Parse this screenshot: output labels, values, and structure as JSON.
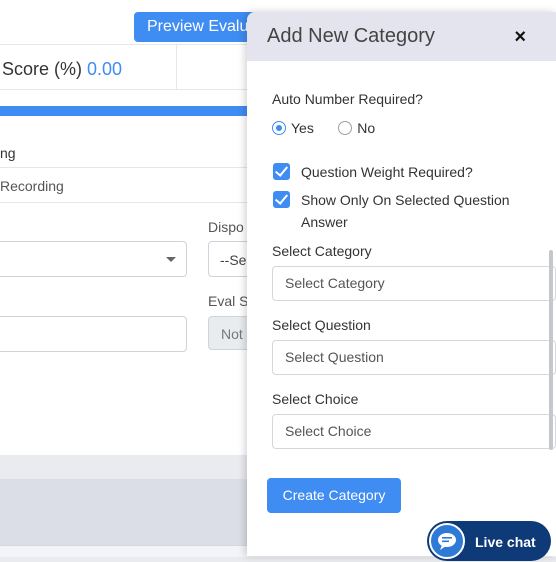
{
  "background": {
    "preview_button_label": "Preview Evaluation",
    "score_label": "Score (%)",
    "score_value": "0.00",
    "progress": 1.0,
    "row1_text": "ng",
    "row2_text": "Recording",
    "disposition_label": "Dispo",
    "disposition_value": "--Se",
    "eval_label": "Eval S",
    "eval_value": "Not"
  },
  "modal": {
    "title": "Add New Category",
    "close": "×",
    "auto_number_label": "Auto Number Required?",
    "auto_number_options": [
      "Yes",
      "No"
    ],
    "auto_number_selected": "Yes",
    "question_weight_label": "Question Weight Required?",
    "question_weight_checked": true,
    "show_only_label_line1": "Show Only On Selected Question",
    "show_only_label_line2": "Answer",
    "show_only_checked": true,
    "category_label": "Select Category",
    "category_placeholder": "Select Category",
    "question_label": "Select Question",
    "question_placeholder": "Select Question",
    "choice_label": "Select Choice",
    "choice_placeholder": "Select Choice",
    "create_button": "Create Category"
  },
  "live_chat": {
    "label": "Live chat"
  },
  "colors": {
    "accent": "#3f8cf2",
    "modal_header": "#e4e4ee",
    "chat": "#0e3a78"
  }
}
